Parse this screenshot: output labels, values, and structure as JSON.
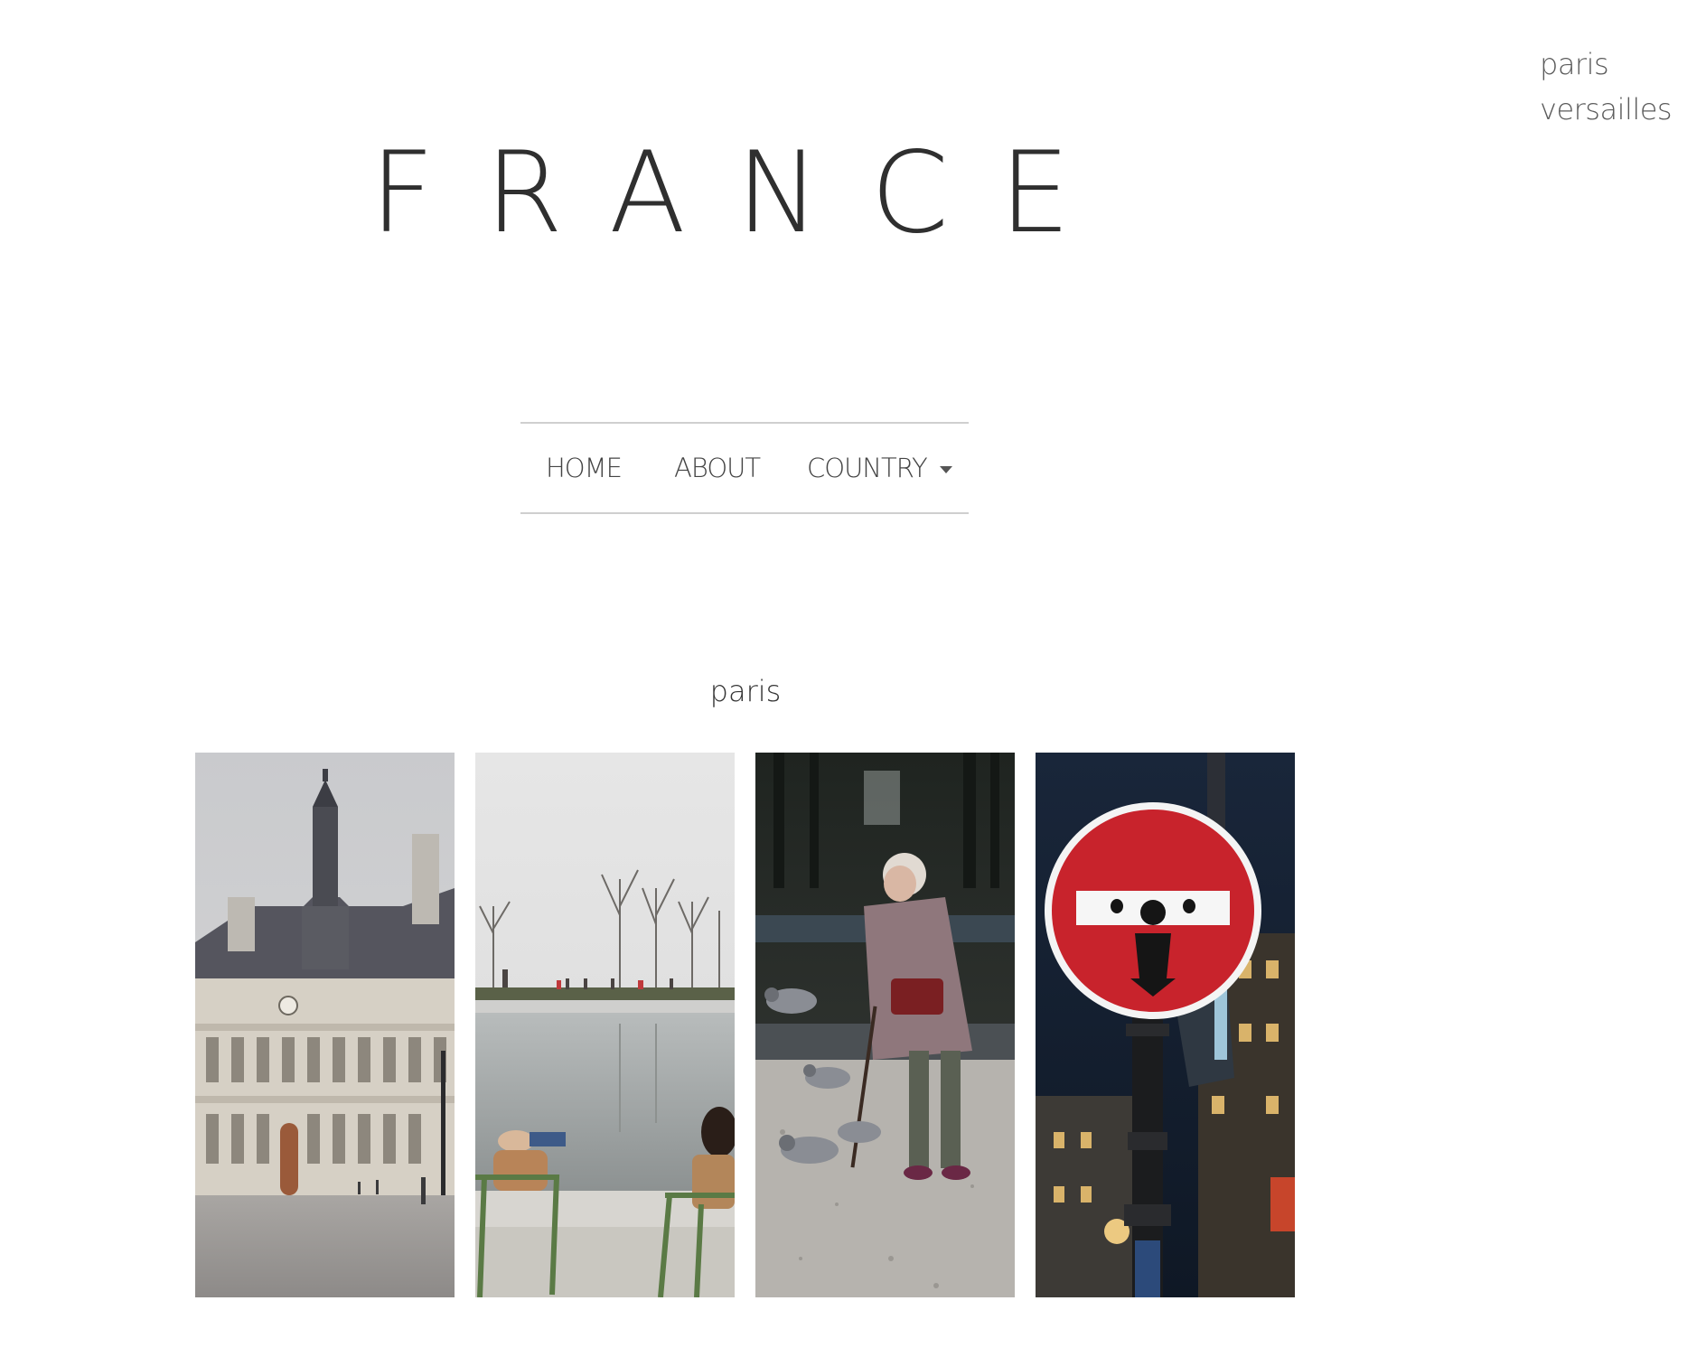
{
  "side_nav": {
    "items": [
      "paris",
      "versailles"
    ]
  },
  "header": {
    "title": "FRANCE"
  },
  "navbar": {
    "home": "HOME",
    "about": "ABOUT",
    "country": "COUNTRY"
  },
  "section": {
    "heading": "paris"
  },
  "gallery": {
    "photos": [
      {
        "subject": "city-hall-building"
      },
      {
        "subject": "garden-pond"
      },
      {
        "subject": "woman-feeding-pigeons"
      },
      {
        "subject": "no-entry-street-sign"
      }
    ]
  },
  "colors": {
    "text": "#3a3a3a",
    "divider": "#cfcfcf",
    "sign_red": "#c8232c"
  }
}
